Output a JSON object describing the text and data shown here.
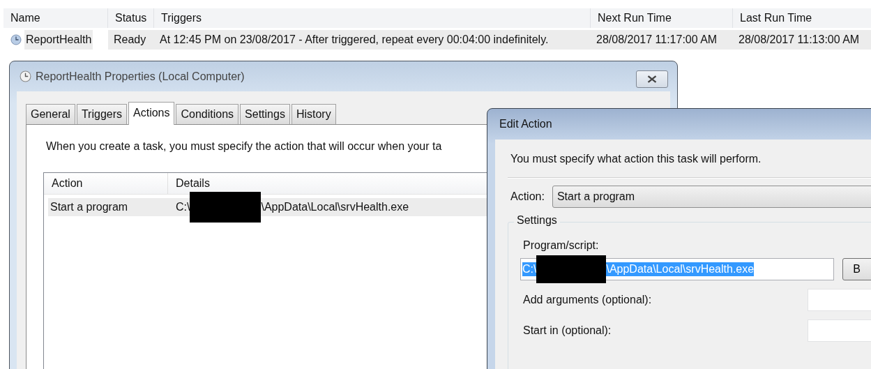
{
  "task_list": {
    "columns": [
      "Name",
      "Status",
      "Triggers",
      "Next Run Time",
      "Last Run Time"
    ],
    "rows": [
      {
        "name": "ReportHealth",
        "status": "Ready",
        "triggers": "At 12:45 PM on 23/08/2017 - After triggered, repeat every 00:04:00 indefinitely.",
        "next_run_time": "28/08/2017 11:17:00 AM",
        "last_run_time": "28/08/2017 11:13:00 AM",
        "selected": true
      }
    ]
  },
  "properties_window": {
    "title": "ReportHealth Properties (Local Computer)",
    "tabs": [
      {
        "label": "General",
        "selected": false
      },
      {
        "label": "Triggers",
        "selected": false
      },
      {
        "label": "Actions",
        "selected": true
      },
      {
        "label": "Conditions",
        "selected": false
      },
      {
        "label": "Settings",
        "selected": false
      },
      {
        "label": "History",
        "selected": false
      }
    ],
    "description": "When you create a task, you must specify the action that will occur when your ta",
    "actions_list": {
      "columns": [
        "Action",
        "Details"
      ],
      "rows": [
        {
          "action": "Start a program",
          "details_prefix": "C:\\",
          "details_suffix": "\\AppData\\Local\\srvHealth.exe",
          "selected": true
        }
      ]
    }
  },
  "edit_action_dialog": {
    "title": "Edit Action",
    "instruction": "You must specify what action this task will perform.",
    "action_label": "Action:",
    "action_value": "Start a program",
    "settings_label": "Settings",
    "program_label": "Program/script:",
    "program_value_prefix": "C:\\",
    "program_value_suffix": "\\AppData\\Local\\srvHealth.exe",
    "program_value_selected": true,
    "browse_button": "B",
    "arguments_label": "Add arguments (optional):",
    "start_in_label": "Start in (optional):"
  }
}
